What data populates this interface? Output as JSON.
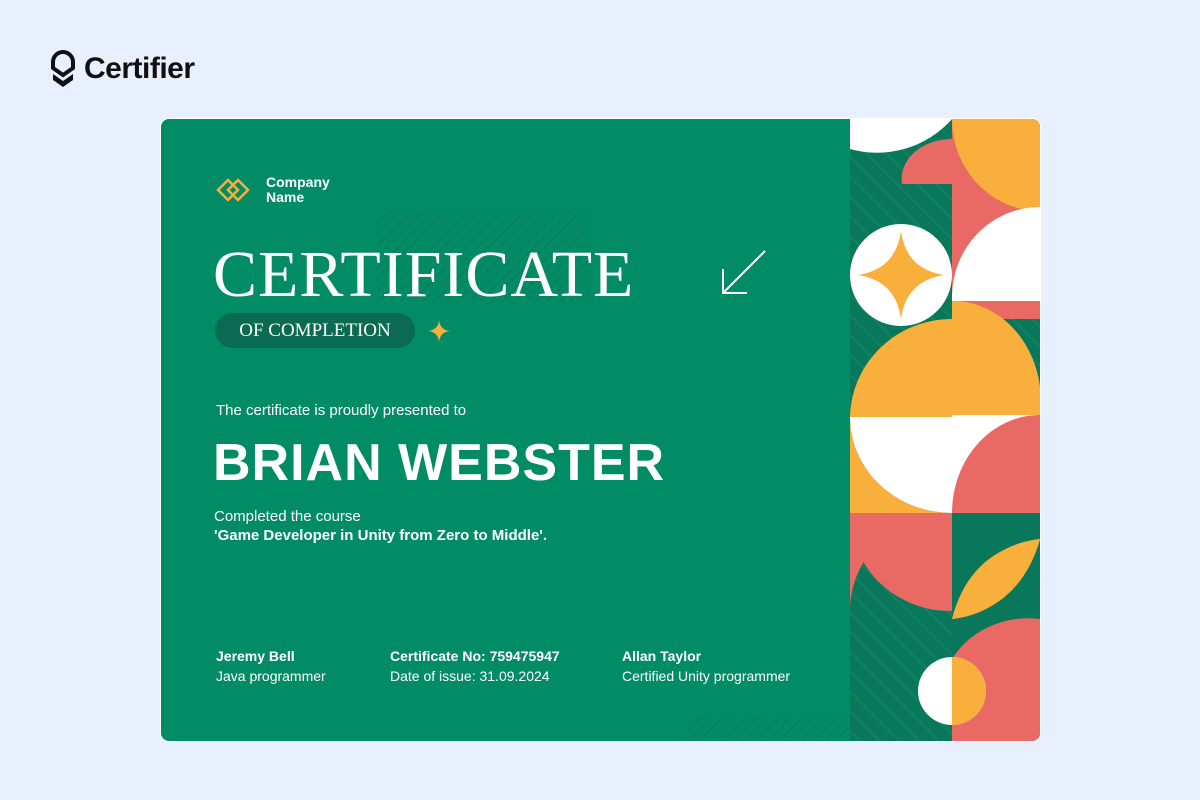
{
  "brand": {
    "name": "Certifier"
  },
  "certificate": {
    "company_name": "Company Name",
    "title": "CERTIFICATE",
    "subtitle": "OF COMPLETION",
    "presented_text": "The certificate is proudly presented to",
    "recipient": "BRIAN WEBSTER",
    "completed_text": "Completed the course",
    "course": "'Game Developer in Unity from Zero to Middle'.",
    "signatures": [
      {
        "name": "Jeremy Bell",
        "role": "Java programmer"
      },
      {
        "name": "Certificate No: 759475947",
        "role": "Date of issue: 31.09.2024"
      },
      {
        "name": "Allan Taylor",
        "role": "Certified Unity programmer"
      }
    ]
  },
  "colors": {
    "page_bg": "#e9f0fd",
    "cert_green": "#028c66",
    "dark_green": "#0a6b50",
    "orange": "#f8af3c",
    "coral": "#e96a64",
    "white": "#ffffff"
  }
}
